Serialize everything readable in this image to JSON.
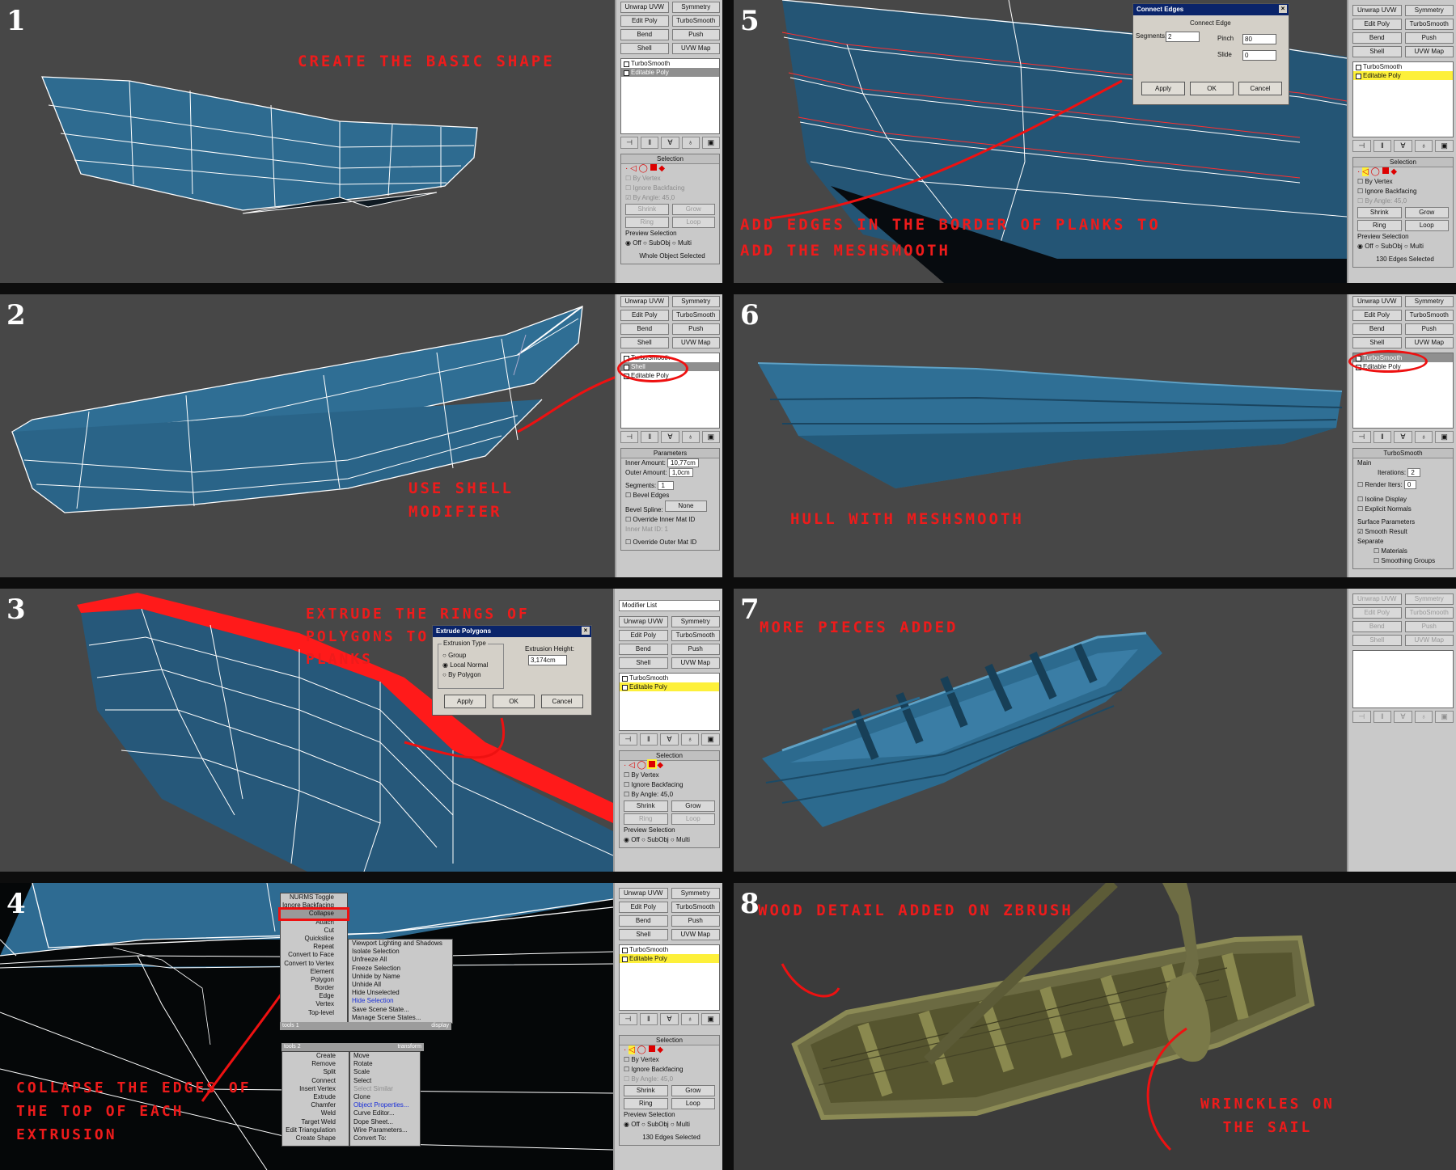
{
  "colors": {
    "viewport_bg": "#474747",
    "hull_blue": "#2f6f96",
    "wire": "#ffffff",
    "annotation": "#ee1b1b",
    "panel_bg": "#c9c9c9",
    "selected_modifier": "#fdf03a",
    "wood": "#6b6a42"
  },
  "steps": [
    {
      "number": "1",
      "annotation": "CREATE THE BASIC SHAPE"
    },
    {
      "number": "2",
      "annotation": "USE SHELL MODIFIER"
    },
    {
      "number": "3",
      "annotation": "EXTRUDE THE RINGS OF POLYGONS TO CREATE THE PLANKS"
    },
    {
      "number": "4",
      "annotation": "COLLAPSE THE EDGES OF THE TOP OF EACH EXTRUSION"
    },
    {
      "number": "5",
      "annotation": "ADD EDGES IN THE BORDER OF PLANKS TO ADD THE MESHSMOOTH"
    },
    {
      "number": "6",
      "annotation": "HULL WITH MESHSMOOTH"
    },
    {
      "number": "7",
      "annotation": "MORE PIECES ADDED"
    },
    {
      "number": "8",
      "annotation": "WOOD DETAIL ADDED ON ZBRUSH",
      "annotation2": "WRINCKLES ON THE SAIL"
    }
  ],
  "modifier_buttons": [
    "Unwrap UVW",
    "Symmetry",
    "Edit Poly",
    "TurboSmooth",
    "Bend",
    "Push",
    "Shell",
    "UVW Map"
  ],
  "modifier_list": "Modifier List",
  "stack": {
    "turbosmooth": "TurboSmooth",
    "shell": "Shell",
    "editable_poly": "Editable Poly"
  },
  "selection": {
    "title": "Selection",
    "by_vertex": "By Vertex",
    "ignore_backfacing": "Ignore Backfacing",
    "by_angle": "By Angle:",
    "angle_value": "45,0",
    "shrink": "Shrink",
    "grow": "Grow",
    "ring": "Ring",
    "loop": "Loop",
    "preview": "Preview Selection",
    "off": "Off",
    "subobj": "SubObj",
    "multi": "Multi",
    "status_whole": "Whole Object Selected",
    "status_edges": "130 Edges Selected"
  },
  "shell_params": {
    "title": "Parameters",
    "inner_label": "Inner Amount:",
    "inner_value": "10,77cm",
    "outer_label": "Outer Amount:",
    "outer_value": "1,0cm",
    "segments_label": "Segments:",
    "segments_value": "1",
    "bevel_edges": "Bevel Edges",
    "bevel_spline": "Bevel Spline:",
    "none": "None",
    "override_inner": "Override Inner Mat ID",
    "inner_mat": "Inner Mat ID:",
    "inner_mat_value": "1",
    "override_outer": "Override Outer Mat ID"
  },
  "turbosmooth_params": {
    "title": "TurboSmooth",
    "main": "Main",
    "iterations": "Iterations:",
    "iterations_value": "2",
    "render_iters": "Render Iters:",
    "render_iters_value": "0",
    "isoline": "Isoline Display",
    "explicit": "Explicit Normals",
    "surface": "Surface Parameters",
    "smooth_result": "Smooth Result",
    "separate": "Separate",
    "materials": "Materials",
    "smoothing_groups": "Smoothing Groups"
  },
  "extrude_dialog": {
    "title": "Extrude Polygons",
    "type_label": "Extrusion Type",
    "group": "Group",
    "local_normal": "Local Normal",
    "by_polygon": "By Polygon",
    "height_label": "Extrusion Height:",
    "height_value": "3,174cm",
    "apply": "Apply",
    "ok": "OK",
    "cancel": "Cancel"
  },
  "connect_dialog": {
    "title": "Connect Edges",
    "heading": "Connect Edge",
    "segments_label": "Segments:",
    "segments_value": "2",
    "pinch_label": "Pinch",
    "pinch_value": "80",
    "slide_label": "Slide",
    "slide_value": "0",
    "apply": "Apply",
    "ok": "OK",
    "cancel": "Cancel"
  },
  "quad_menu": {
    "top_left": [
      "NURMS Toggle",
      "Ignore Backfacing",
      "Collapse",
      "Attach",
      "Cut",
      "Quickslice",
      "Repeat",
      "Convert to Face",
      "Convert to Vertex",
      "Element",
      "Polygon",
      "Border",
      "Edge",
      "Vertex",
      "Top-level"
    ],
    "top_right": [
      "Viewport Lighting and Shadows",
      "Isolate Selection",
      "Unfreeze All",
      "Freeze Selection",
      "Unhide by Name",
      "Unhide All",
      "Hide Unselected",
      "Hide Selection",
      "Save Scene State...",
      "Manage Scene States..."
    ],
    "tools1": "tools 1",
    "display": "display",
    "tools2": "tools 2",
    "transform": "transform",
    "bottom_left": [
      "Create",
      "Remove",
      "Split",
      "Connect",
      "Insert Vertex",
      "Extrude",
      "Chamfer",
      "Weld",
      "Target Weld",
      "Edit Triangulation",
      "Create Shape"
    ],
    "bottom_right": [
      "Move",
      "Rotate",
      "Scale",
      "Select",
      "Select Similar",
      "Clone",
      "Object Properties...",
      "Curve Editor...",
      "Dope Sheet...",
      "Wire Parameters...",
      "Convert To:"
    ]
  }
}
